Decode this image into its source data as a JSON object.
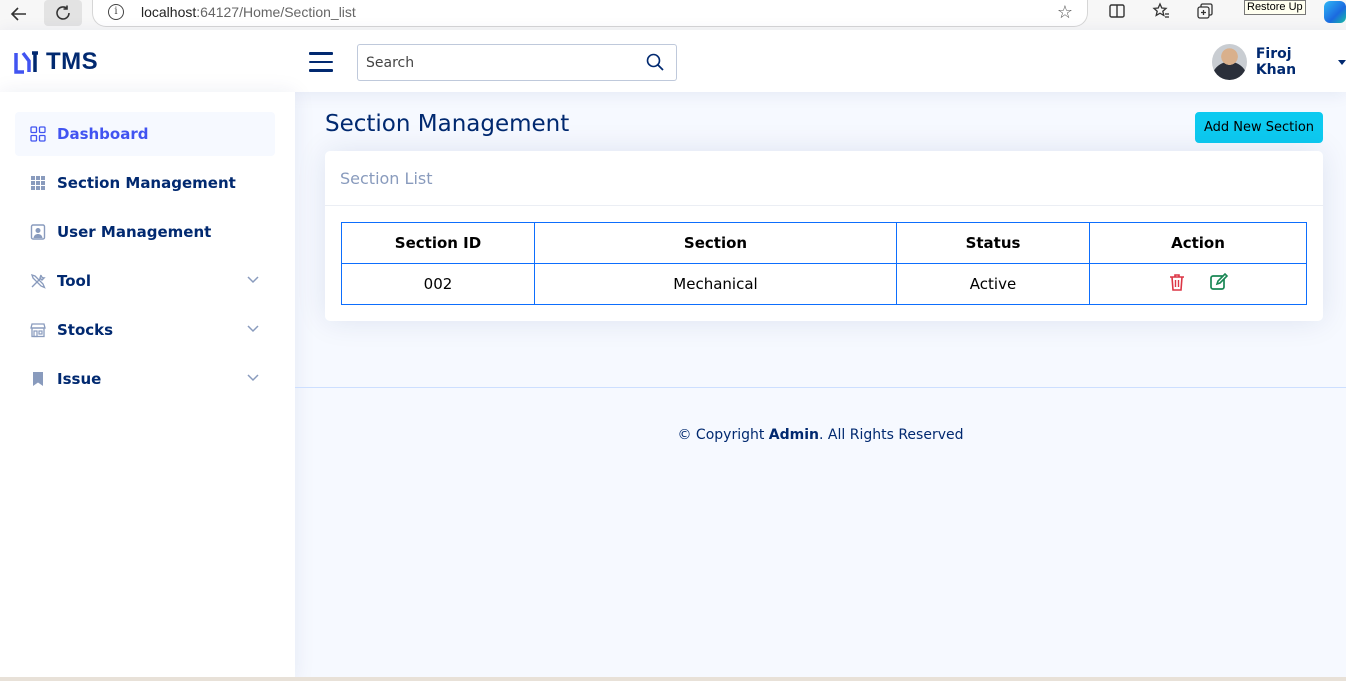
{
  "browser": {
    "url_host": "localhost",
    "url_rest": ":64127/Home/Section_list",
    "tooltip": "Restore Up"
  },
  "header": {
    "brand": "TMS",
    "search_placeholder": "Search",
    "user_name": "Firoj Khan"
  },
  "sidebar": {
    "items": [
      {
        "label": "Dashboard",
        "icon": "grid-icon",
        "active": true
      },
      {
        "label": "Section Management",
        "icon": "apps-icon"
      },
      {
        "label": "User Management",
        "icon": "person-badge-icon"
      },
      {
        "label": "Tool",
        "icon": "tools-icon",
        "expandable": true
      },
      {
        "label": "Stocks",
        "icon": "shop-icon",
        "expandable": true
      },
      {
        "label": "Issue",
        "icon": "bookmark-icon",
        "expandable": true
      }
    ]
  },
  "main": {
    "title": "Section Management",
    "add_button": "Add New Section",
    "card_title": "Section List",
    "table": {
      "headers": [
        "Section ID",
        "Section",
        "Status",
        "Action"
      ],
      "rows": [
        {
          "id": "002",
          "section": "Mechanical",
          "status": "Active"
        }
      ]
    }
  },
  "footer": {
    "prefix": "© Copyright ",
    "owner": "Admin",
    "suffix": ". All Rights Reserved"
  },
  "colors": {
    "primary": "#012970",
    "accent": "#4154f1",
    "info": "#0dcaf0",
    "delete": "#dc3545",
    "edit": "#198754",
    "table_border": "#0d6efd"
  }
}
